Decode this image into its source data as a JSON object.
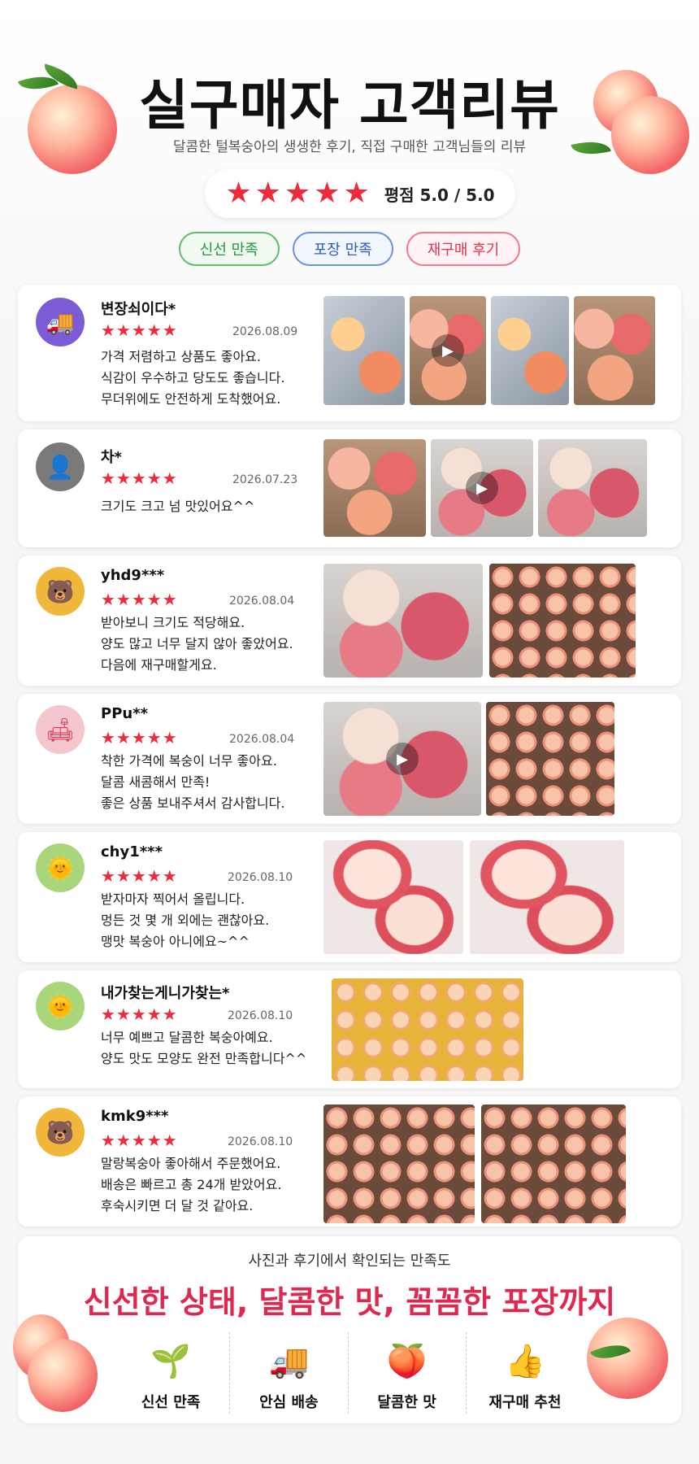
{
  "header": {
    "title": "실구매자 고객리뷰",
    "subtitle": "달콤한 털복숭아의 생생한 후기, 직접 구매한 고객님들의 리뷰",
    "stars": "★★★★★",
    "rating_text": "평점 5.0 / 5.0"
  },
  "chips": [
    "신선 만족",
    "포장 만족",
    "재구매 후기"
  ],
  "reviews": [
    {
      "name": "변장쇠이다*",
      "stars": "★★★★★",
      "date": "2026.08.09",
      "text": "가격 저렴하고 상품도 좋아요.\n식감이 우수하고 당도도 좋습니다.\n무더위에도 안전하게 도착했어요.",
      "avatar_icon": "truck-icon"
    },
    {
      "name": "차*",
      "stars": "★★★★★",
      "date": "2026.07.23",
      "text": "크기도 크고 넘 맛있어요^^",
      "avatar_icon": "person-icon"
    },
    {
      "name": "yhd9***",
      "stars": "★★★★★",
      "date": "2026.08.04",
      "text": "받아보니 크기도 적당해요.\n양도 많고 너무 달지 않아 좋았어요.\n다음에 재구매할게요.",
      "avatar_icon": "bear-icon"
    },
    {
      "name": "PPu**",
      "stars": "★★★★★",
      "date": "2026.08.04",
      "text": "착한 가격에 복숭이 너무 좋아요.\n달콤 새콤해서 만족!\n좋은 상품 보내주셔서 감사합니다.",
      "avatar_icon": "sofa-icon"
    },
    {
      "name": "chy1***",
      "stars": "★★★★★",
      "date": "2026.08.10",
      "text": "받자마자 찍어서 올립니다.\n멍든 것 몇 개 외에는 괜찮아요.\n맹맛 복숭아 아니에요~^^",
      "avatar_icon": "sun-icon"
    },
    {
      "name": "내가찾는게니가찾는*",
      "stars": "★★★★★",
      "date": "2026.08.10",
      "text": "너무 예쁘고 달콤한 복숭아예요.\n양도 맛도 모양도 완전 만족합니다^^",
      "avatar_icon": "sun-icon"
    },
    {
      "name": "kmk9***",
      "stars": "★★★★★",
      "date": "2026.08.10",
      "text": "말랑복숭아 좋아해서 주문했어요.\n배송은 빠르고 총 24개 받았어요.\n후숙시키면 더 달 것 같아요.",
      "avatar_icon": "bear-icon"
    }
  ],
  "bottom": {
    "subtitle": "사진과 후기에서 확인되는 만족도",
    "title": "신선한 상태, 달콤한 맛, 꼼꼼한 포장까지",
    "features": [
      {
        "label": "신선 만족",
        "icon": "leaf-icon"
      },
      {
        "label": "안심 배송",
        "icon": "truck-icon"
      },
      {
        "label": "달콤한 맛",
        "icon": "peach-icon"
      },
      {
        "label": "재구매 추천",
        "icon": "thumbs-up-icon"
      }
    ]
  },
  "colors": {
    "accent": "#ef2b3b",
    "title_pink": "#e0284f",
    "chip_green": "#23973a",
    "chip_blue": "#2a5cc4",
    "chip_red": "#e4314e"
  }
}
